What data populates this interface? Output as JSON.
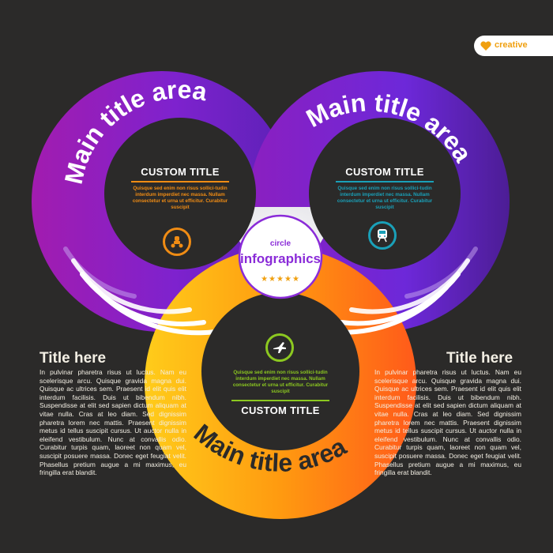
{
  "brand": {
    "label": "creative",
    "icon": "heart-icon",
    "color": "#f0a010"
  },
  "center": {
    "line1": "circle",
    "line2": "infographics",
    "stars": "★★★★★",
    "color": "#8a2bd8"
  },
  "circles": [
    {
      "arc_title": "Main title area",
      "title": "CUSTOM TITLE",
      "body": "Quisque sed enim non risus sollici-tudin interdum imperdiet nec massa. Nullam consectetur et urna ut efficitur. Curabitur suscipit",
      "accent": "#f08c14",
      "icon": "scooter-icon"
    },
    {
      "arc_title": "Main title area",
      "title": "CUSTOM TITLE",
      "body": "Quisque sed enim non risus sollici-tudin interdum imperdiet nec massa. Nullam consectetur et urna ut efficitur. Curabitur suscipit",
      "accent": "#1aa0b8",
      "icon": "train-icon"
    },
    {
      "arc_title": "Main title area",
      "title": "CUSTOM TITLE",
      "body": "Quisque sed enim non risus sollici-tudin interdum imperdiet nec massa. Nullam consectetur et urna ut efficitur. Curabitur suscipit",
      "accent": "#8cc820",
      "icon": "airplane-icon"
    }
  ],
  "side_left": {
    "title": "Title here",
    "body": "In pulvinar pharetra risus ut luctus. Nam eu scelerisque arcu. Quisque gravida magna dui. Quisque ac ultrices sem. Praesent id elit quis elit interdum facilisis. Duis ut bibendum nibh. Suspendisse at elit sed sapien dictum aliquam at vitae nulla. Cras at leo diam. Sed dignissim pharetra lorem nec mattis. Praesent dignissim metus id tellus suscipit cursus. Ut auctor nulla in eleifend vestibulum. Nunc at convallis odio. Curabitur turpis quam, laoreet non quam vel, suscipit posuere massa. Donec eget feugiat velit. Phasellus pretium augue a mi maximus, eu fringilla erat blandit."
  },
  "side_right": {
    "title": "Title here",
    "body": "In pulvinar pharetra risus ut luctus. Nam eu scelerisque arcu. Quisque gravida magna dui. Quisque ac ultrices sem. Praesent id elit quis elit interdum facilisis. Duis ut bibendum nibh. Suspendisse at elit sed sapien dictum aliquam at vitae nulla. Cras at leo diam. Sed dignissim pharetra lorem nec mattis. Praesent dignissim metus id tellus suscipit cursus. Ut auctor nulla in eleifend vestibulum. Nunc at convallis odio. Curabitur turpis quam, laoreet non quam vel, suscipit posuere massa. Donec eget feugiat velit. Phasellus pretium augue a mi maximus, eu fringilla erat blandit."
  }
}
